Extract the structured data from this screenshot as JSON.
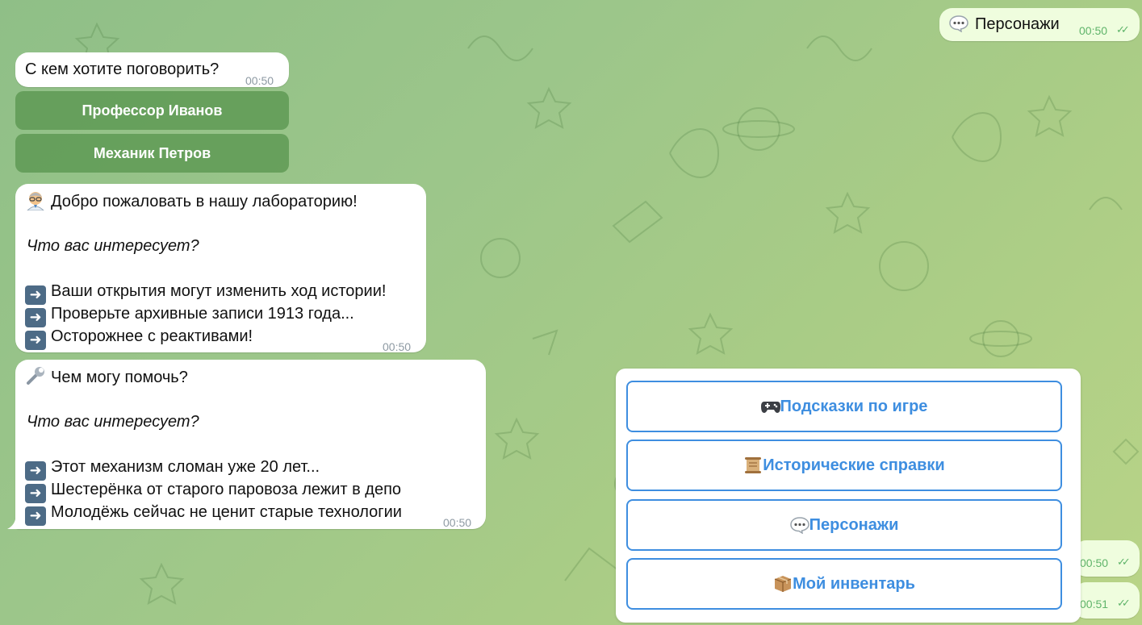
{
  "outgoing": [
    {
      "text": "Персонажи",
      "time": "00:50",
      "icon": "speech-bubble-icon"
    },
    {
      "text": "",
      "time": "00:50"
    },
    {
      "text": "",
      "time": "00:51"
    }
  ],
  "ask": {
    "text": "С кем хотите поговорить?",
    "time": "00:50",
    "buttons": [
      "Профессор Иванов",
      "Механик Петров"
    ]
  },
  "professor": {
    "greeting": "Добро пожаловать в нашу лабораторию!",
    "question": "Что вас интересует?",
    "items": [
      "Ваши открытия могут изменить ход истории!",
      "Проверьте архивные записи 1913 года...",
      "Осторожнее с реактивами!"
    ],
    "time": "00:50",
    "icon": "scientist-icon"
  },
  "mechanic": {
    "greeting": "Чем могу помочь?",
    "question": "Что вас интересует?",
    "items": [
      "Этот механизм сломан уже 20 лет...",
      "Шестерёнка от старого паровоза лежит в депо",
      "Молодёжь сейчас не ценит старые технологии"
    ],
    "time": "00:50",
    "icon": "wrench-icon"
  },
  "keyboard": {
    "buttons": [
      {
        "label": "Подсказки по игре",
        "icon": "gamepad-icon"
      },
      {
        "label": "Исторические справки",
        "icon": "scroll-icon"
      },
      {
        "label": "Персонажи",
        "icon": "speech-bubble-icon"
      },
      {
        "label": "Мой инвентарь",
        "icon": "package-icon"
      }
    ]
  },
  "colors": {
    "accent": "#3e8ee0",
    "inline_button": "#5a9650",
    "read_check": "#5fb46a"
  }
}
